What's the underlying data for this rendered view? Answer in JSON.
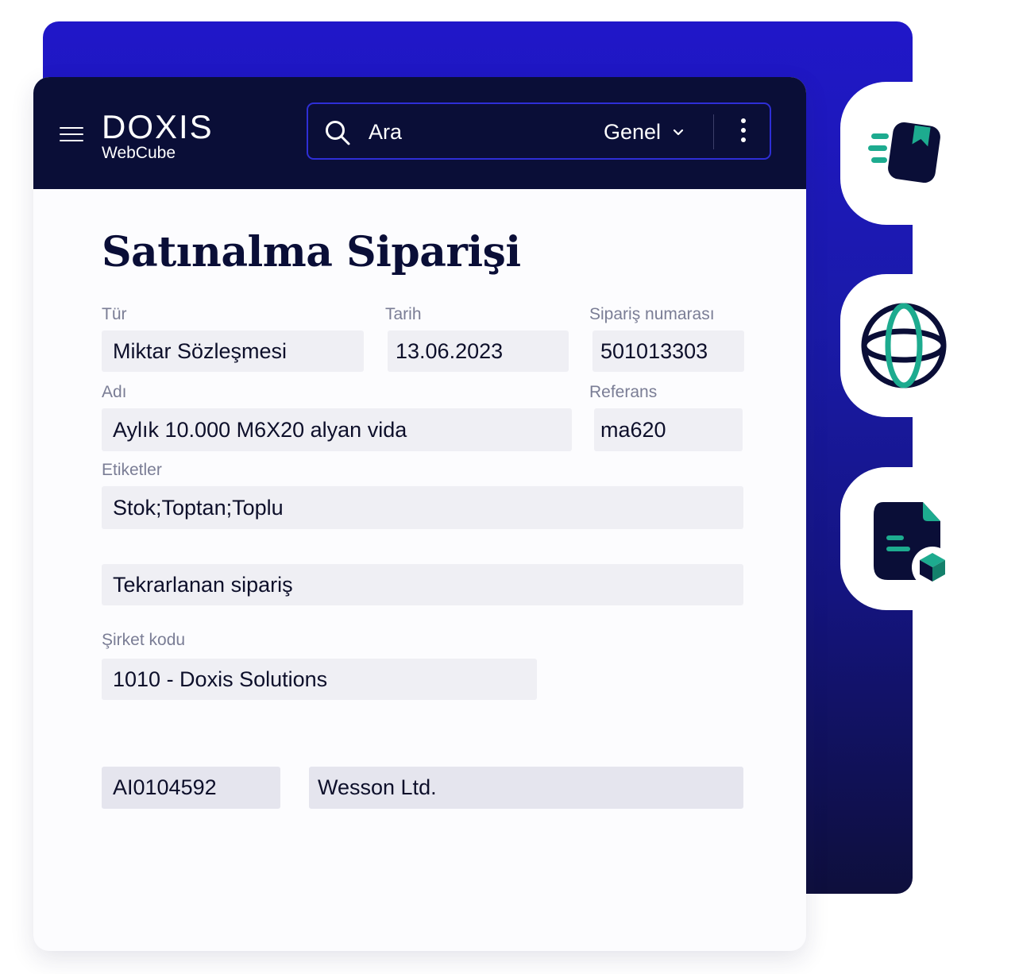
{
  "app": {
    "logo_main": "DOXIS",
    "logo_sub": "WebCube"
  },
  "search": {
    "placeholder": "Ara",
    "scope": "Genel"
  },
  "side_icons": [
    "book-bookmark-icon",
    "globe-icon",
    "document-cube-icon"
  ],
  "colors": {
    "primary_blue": "#2017c9",
    "navy": "#0a0e37",
    "accent_teal": "#1dab8f",
    "field_bg": "#efeff4"
  },
  "form": {
    "title": "Satınalma Siparişi",
    "type": {
      "label": "Tür",
      "value": "Miktar Sözleşmesi"
    },
    "date": {
      "label": "Tarih",
      "value": "13.06.2023"
    },
    "order_number": {
      "label": "Sipariş numarası",
      "value": "501013303"
    },
    "name": {
      "label": "Adı",
      "value": "Aylık 10.000 M6X20 alyan vida"
    },
    "reference": {
      "label": "Referans",
      "value": "ma620"
    },
    "tags": {
      "label": "Etiketler",
      "value": "Stok;Toptan;Toplu"
    },
    "recurring": {
      "value": "Tekrarlanan sipariş"
    },
    "company_code": {
      "label": "Şirket kodu",
      "value": "1010 - Doxis Solutions"
    },
    "vendor_id": {
      "value": "AI0104592"
    },
    "vendor_name": {
      "value": "Wesson Ltd."
    }
  }
}
